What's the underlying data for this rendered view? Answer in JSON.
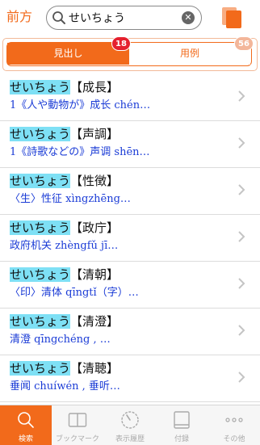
{
  "colors": {
    "accent": "#f26a1b",
    "highlight": "#7ee0f5",
    "subtext": "#1a3bd6",
    "badge_red": "#e5202e",
    "badge_pale": "#f3b69a"
  },
  "topbar": {
    "back_label": "前方",
    "search_value": "せいちょう",
    "search_icon": "search-icon",
    "clear_icon": "clear-icon",
    "copy_icon": "copy-icon"
  },
  "segment": {
    "left_label": "見出し",
    "left_count": "18",
    "right_label": "用例",
    "right_count": "56"
  },
  "results": [
    {
      "reading": "せいちょう",
      "kanji": "【成長】",
      "sub": "1《人や動物が》成长 chén…"
    },
    {
      "reading": "せいちょう",
      "kanji": "【声調】",
      "sub": "1《詩歌などの》声调 shēn…"
    },
    {
      "reading": "せいちょう",
      "kanji": "【性徴】",
      "sub": "〈生〉性征 xìngzhēng…"
    },
    {
      "reading": "せいちょう",
      "kanji": "【政庁】",
      "sub": "政府机关 zhèngfǔ jī…"
    },
    {
      "reading": "せいちょう",
      "kanji": "【清朝】",
      "sub": "〈印〉清体 qīngtǐ（字）…"
    },
    {
      "reading": "せいちょう",
      "kanji": "【清澄】",
      "sub": "清澄 qīngchéng , …"
    },
    {
      "reading": "せいちょう",
      "kanji": "【清聴】",
      "sub": "垂闻 chuíwén , 垂听…"
    }
  ],
  "tabs": [
    {
      "label": "検索",
      "icon": "search-icon"
    },
    {
      "label": "ブックマーク",
      "icon": "book-icon"
    },
    {
      "label": "表示履歴",
      "icon": "history-icon"
    },
    {
      "label": "付録",
      "icon": "appendix-icon"
    },
    {
      "label": "その他",
      "icon": "more-icon"
    }
  ]
}
